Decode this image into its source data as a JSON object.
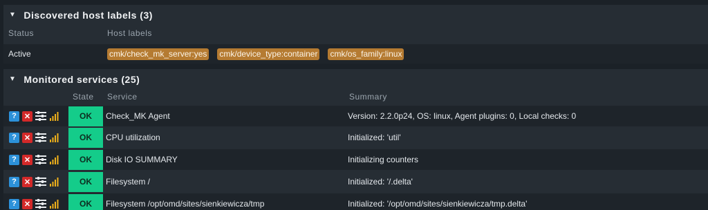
{
  "labels_section": {
    "title": "Discovered host labels (3)",
    "columns": {
      "status": "Status",
      "host_labels": "Host labels"
    },
    "row": {
      "status": "Active",
      "labels": [
        "cmk/check_mk_server:yes",
        "cmk/device_type:container",
        "cmk/os_family:linux"
      ]
    }
  },
  "services_section": {
    "title": "Monitored services (25)",
    "columns": {
      "state": "State",
      "service": "Service",
      "summary": "Summary"
    },
    "rows": [
      {
        "state": "OK",
        "service": "Check_MK Agent",
        "summary": "Version: 2.2.0p24, OS: linux, Agent plugins: 0, Local checks: 0"
      },
      {
        "state": "OK",
        "service": "CPU utilization",
        "summary": "Initialized: 'util'"
      },
      {
        "state": "OK",
        "service": "Disk IO SUMMARY",
        "summary": "Initializing counters"
      },
      {
        "state": "OK",
        "service": "Filesystem /",
        "summary": "Initialized: '/.delta'"
      },
      {
        "state": "OK",
        "service": "Filesystem /opt/omd/sites/sienkiewicza/tmp",
        "summary": "Initialized: '/opt/omd/sites/sienkiewicza/tmp.delta'"
      }
    ]
  },
  "icons": {
    "help": "help-icon",
    "remove": "remove-icon",
    "parameters": "parameters-icon",
    "graph": "perf-graph-icon"
  },
  "colors": {
    "ok": "#14cc8a",
    "label_chip": "#b57b32",
    "help": "#2c91d9",
    "remove": "#d32929",
    "graph_bars": "#f2b21a"
  }
}
